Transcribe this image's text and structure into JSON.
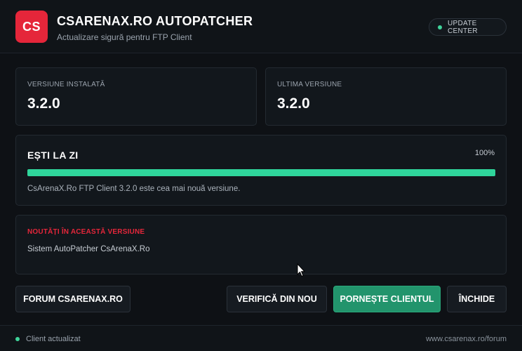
{
  "header": {
    "logo_text": "CS",
    "title": "CSARENAX.RO AUTOPATCHER",
    "subtitle": "Actualizare sigură pentru FTP Client",
    "update_center_label": "UPDATE CENTER"
  },
  "versions": {
    "installed_label": "VERSIUNE INSTALATĂ",
    "installed_value": "3.2.0",
    "latest_label": "ULTIMA VERSIUNE",
    "latest_value": "3.2.0"
  },
  "status": {
    "title": "EȘTI LA ZI",
    "percent_label": "100%",
    "progress_percent": 100,
    "message": "CsArenaX.Ro FTP Client 3.2.0 este cea mai nouă versiune."
  },
  "news": {
    "title": "NOUTĂȚI ÎN ACEASTĂ VERSIUNE",
    "text": "Sistem AutoPatcher CsArenaX.Ro"
  },
  "buttons": {
    "forum": "FORUM CSARENAX.RO",
    "check_again": "VERIFICĂ DIN NOU",
    "start_client": "PORNEȘTE CLIENTUL",
    "close": "ÎNCHIDE"
  },
  "footer": {
    "status_text": "Client actualizat",
    "link_text": "www.csarenax.ro/forum"
  },
  "colors": {
    "accent_red": "#e5263a",
    "accent_green": "#2fd59b",
    "primary_button": "#22946c"
  }
}
